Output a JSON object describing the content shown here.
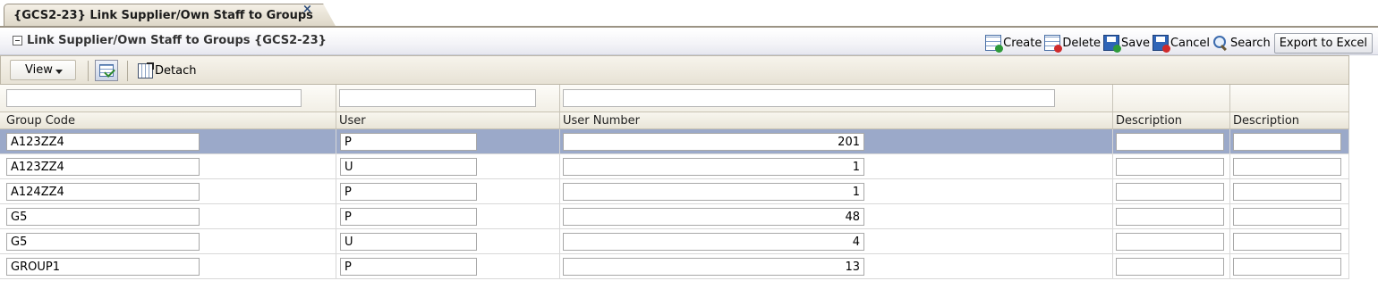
{
  "tab": {
    "title": "{GCS2-23} Link Supplier/Own Staff to Groups",
    "close_symbol": "×"
  },
  "panel": {
    "title": "Link Supplier/Own Staff to Groups {GCS2-23}",
    "actions": {
      "create": "Create",
      "delete": "Delete",
      "save": "Save",
      "cancel": "Cancel",
      "search": "Search",
      "export": "Export to Excel"
    }
  },
  "toolbar": {
    "view_label": "View",
    "detach_label": "Detach"
  },
  "table": {
    "headers": [
      "Group Code",
      "User",
      "User Number",
      "Description",
      "Description"
    ],
    "filters": [
      "",
      "",
      "",
      "",
      ""
    ],
    "rows": [
      {
        "group_code": "A123ZZ4",
        "user": "P",
        "user_number": "201",
        "description1": "",
        "description2": "",
        "selected": true
      },
      {
        "group_code": "A123ZZ4",
        "user": "U",
        "user_number": "1",
        "description1": "",
        "description2": "",
        "selected": false
      },
      {
        "group_code": "A124ZZ4",
        "user": "P",
        "user_number": "1",
        "description1": "",
        "description2": "",
        "selected": false
      },
      {
        "group_code": "G5",
        "user": "P",
        "user_number": "48",
        "description1": "",
        "description2": "",
        "selected": false
      },
      {
        "group_code": "G5",
        "user": "U",
        "user_number": "4",
        "description1": "",
        "description2": "",
        "selected": false
      },
      {
        "group_code": "GROUP1",
        "user": "P",
        "user_number": "13",
        "description1": "",
        "description2": "",
        "selected": false
      }
    ]
  },
  "colors": {
    "selected_row": "#9ba9c9",
    "header_gradient_top": "#f8f6ef",
    "tab_border": "#9b9384",
    "create_badge": "#2e9a3a",
    "delete_badge": "#d02a2a",
    "save_badge": "#2e9a3a",
    "cancel_badge": "#d02a2a"
  },
  "icons": {
    "create": "table-add-icon",
    "delete": "table-delete-icon",
    "save": "floppy-save-icon",
    "cancel": "floppy-cancel-icon",
    "search": "magnifier-icon",
    "freeze": "freeze-columns-icon",
    "detach": "detach-icon"
  }
}
